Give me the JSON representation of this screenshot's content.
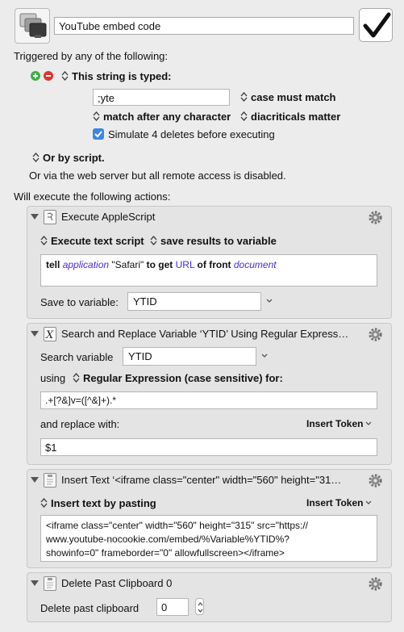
{
  "macro": {
    "name": "YouTube embed code",
    "icon": "clipboard-copy-icon",
    "enabled_icon": "checkmark-icon"
  },
  "triggers": {
    "heading": "Triggered by any of the following:",
    "typed_trigger_label": "This string is typed:",
    "typed_string": ";yte",
    "case_option": "case must match",
    "match_option": "match after any character",
    "diacritics_option": "diacriticals matter",
    "simulate_deletes_label": "Simulate 4 deletes before executing",
    "simulate_deletes_checked": true,
    "script_trigger_label": "Or by script.",
    "web_server_note": "Or via the web server but all remote access is disabled."
  },
  "actions_heading": "Will execute the following actions:",
  "actions": [
    {
      "title": "Execute AppleScript",
      "icon": "applescript-icon",
      "mode": "Execute text script",
      "result": "save results to variable",
      "script": {
        "tell": "tell",
        "application": "application",
        "safari": "\"Safari\"",
        "to_get": "to get",
        "url": "URL",
        "of_front": "of front",
        "document": "document"
      },
      "save_label": "Save to variable:",
      "save_var": "YTID"
    },
    {
      "title": "Search and Replace Variable ‘YTID’ Using Regular Express…",
      "icon": "variable-x-icon",
      "search_label": "Search variable",
      "search_var": "YTID",
      "using_label": "using",
      "mode": "Regular Expression (case sensitive) for:",
      "pattern": ".+[?&]v=([^&]+).*",
      "replace_label": "and replace with:",
      "insert_token": "Insert Token",
      "replacement": "$1"
    },
    {
      "title": "Insert Text ‘<iframe class=\"center\" width=\"560\" height=\"31…",
      "icon": "clipboard-icon",
      "mode": "Insert text by pasting",
      "insert_token": "Insert Token",
      "text_line1": "<iframe class=\"center\" width=\"560\" height=\"315\" src=\"https://",
      "text_line2": "www.youtube-nocookie.com/embed/%Variable%YTID%?",
      "text_line3": "showinfo=0\" frameborder=\"0\" allowfullscreen></iframe>"
    },
    {
      "title": "Delete Past Clipboard 0",
      "icon": "clipboard-icon",
      "label": "Delete past clipboard",
      "value": "0"
    }
  ],
  "colors": {
    "add": "#3cb043",
    "remove": "#e0342c",
    "accent": "#3a86e6",
    "keyword_purple": "#4b2bd6"
  }
}
